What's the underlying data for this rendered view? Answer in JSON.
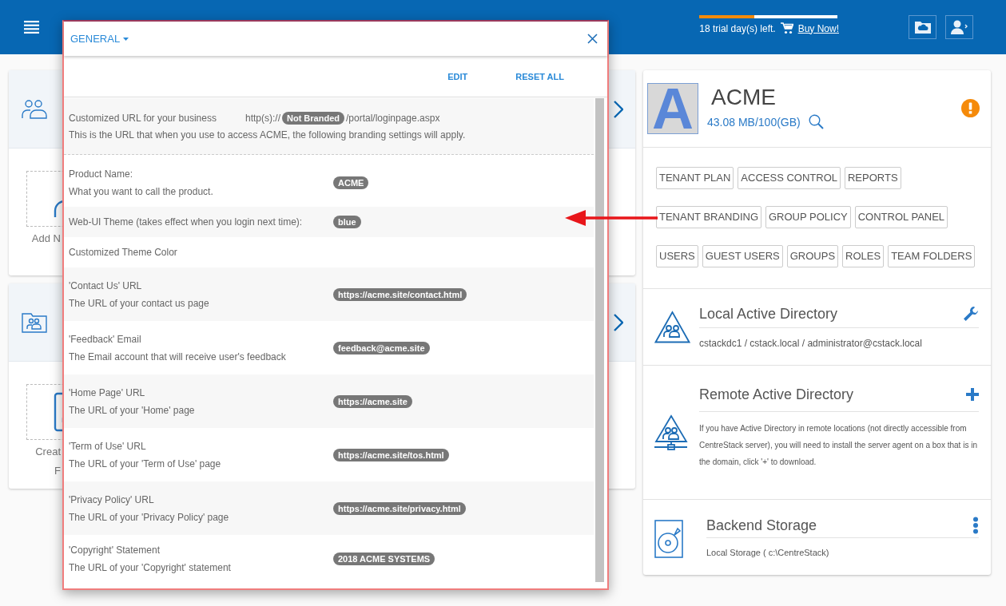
{
  "header": {
    "trial": {
      "level": 0.4,
      "text": "18 trial day(s) left.",
      "buy_link": "Buy Now!"
    }
  },
  "left_cards": [
    {
      "kind": "users",
      "action_lines": [
        "Add N"
      ]
    },
    {
      "kind": "team-folder",
      "action_lines": [
        "Creat",
        "F"
      ]
    }
  ],
  "modal": {
    "menu": "GENERAL",
    "actions": [
      "EDIT",
      "RESET ALL"
    ],
    "settings": [
      {
        "kind": "url",
        "label": "Customized URL for your business",
        "prefix": "http(s)://",
        "badge": "Not Branded",
        "suffix": "/portal/loginpage.aspx",
        "description": "This is the URL that when you use to access ACME, the following branding settings will apply."
      },
      {
        "kind": "field",
        "label": "Product Name:",
        "description": "What you want to call the product.",
        "value": "ACME"
      },
      {
        "kind": "field",
        "label": "Web-UI Theme (takes effect when you login next time):",
        "value": "blue"
      },
      {
        "kind": "field",
        "label": "Customized Theme Color"
      },
      {
        "kind": "field",
        "label": "'Contact Us' URL",
        "description": "The URL of your contact us page",
        "value": "https://acme.site/contact.html"
      },
      {
        "kind": "field",
        "label": "'Feedback' Email",
        "description": "The Email account that will receive user's feedback",
        "value": "feedback@acme.site"
      },
      {
        "kind": "field",
        "label": "'Home Page' URL",
        "description": "The URL of your 'Home' page",
        "value": "https://acme.site"
      },
      {
        "kind": "field",
        "label": "'Term of Use' URL",
        "description": "The URL of your 'Term of Use' page",
        "value": "https://acme.site/tos.html"
      },
      {
        "kind": "field",
        "label": "'Privacy Policy' URL",
        "description": "The URL of your 'Privacy Policy' page",
        "value": "https://acme.site/privacy.html"
      },
      {
        "kind": "field",
        "label": "'Copyright' Statement",
        "description": "The URL of your 'Copyright' statement",
        "value": "2018 ACME SYSTEMS"
      }
    ]
  },
  "tenant": {
    "logo_letter": "A",
    "name": "ACME",
    "usage": "43.08 MB/100(GB)",
    "menu_rows": [
      {
        "buttons": [
          "TENANT PLAN",
          "ACCESS CONTROL",
          "REPORTS"
        ]
      },
      {
        "buttons": [
          "TENANT BRANDING",
          "GROUP POLICY",
          "CONTROL PANEL"
        ]
      },
      {
        "buttons": [
          "USERS",
          "GUEST USERS",
          "GROUPS",
          "ROLES",
          "TEAM FOLDERS"
        ]
      }
    ],
    "sections": [
      {
        "kind": "local-ad",
        "title": "Local Active Directory",
        "text": "cstackdc1 / cstack.local / administrator@cstack.local"
      },
      {
        "kind": "remote-ad",
        "title": "Remote Active Directory",
        "text": "If you have Active Directory in remote locations (not directly accessible from CentreStack server), you will need to install the server agent on a box that is in the domain, click '+' to download."
      },
      {
        "kind": "storage",
        "title": "Backend Storage",
        "text": "Local Storage ( c:\\CentreStack)"
      }
    ]
  }
}
